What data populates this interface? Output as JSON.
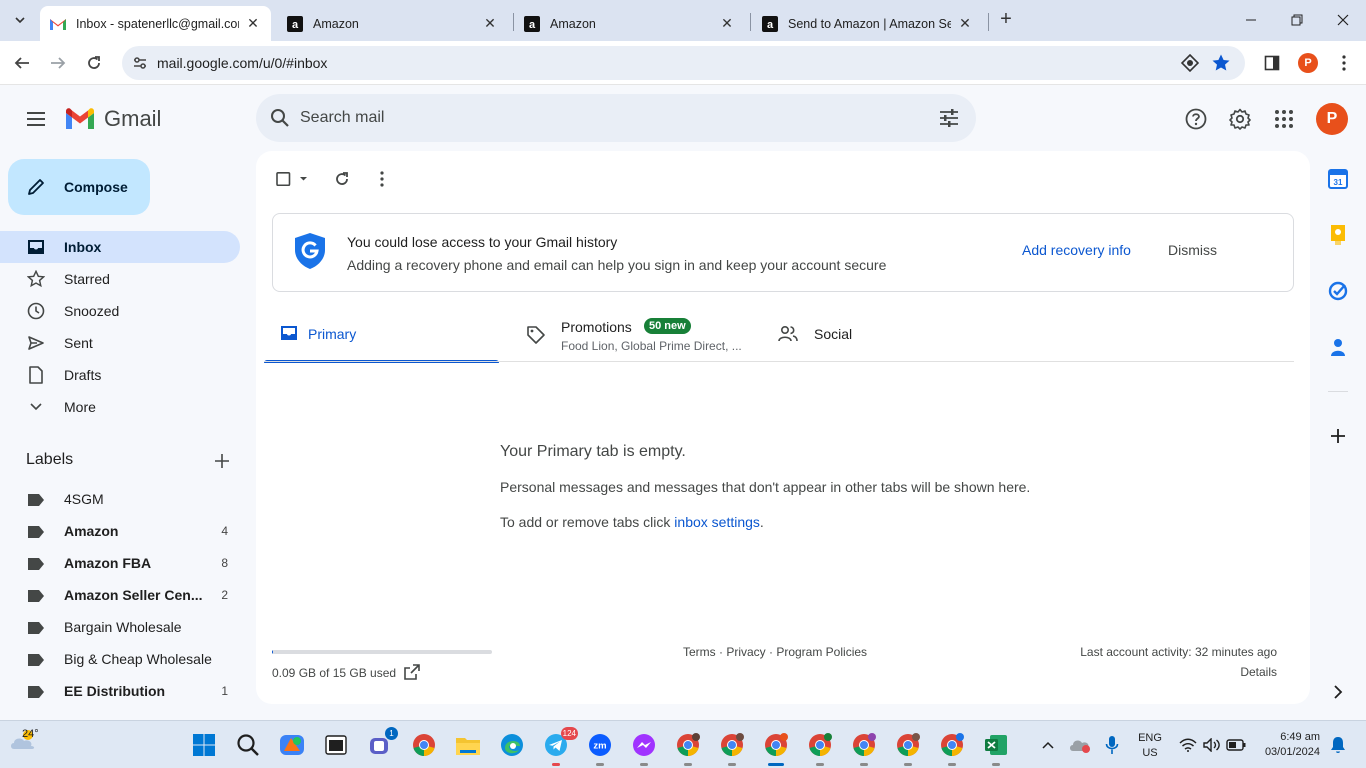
{
  "browser": {
    "tabs": [
      {
        "title": "Inbox - spatenerllc@gmail.com",
        "favicon": "gmail-icon",
        "active": true
      },
      {
        "title": "Amazon",
        "favicon": "amazon-icon",
        "active": false
      },
      {
        "title": "Amazon",
        "favicon": "amazon-icon",
        "active": false
      },
      {
        "title": "Send to Amazon | Amazon Seller Central",
        "favicon": "amazon-icon",
        "active": false
      }
    ],
    "url": "mail.google.com/u/0/#inbox",
    "profile_initial": "P"
  },
  "gmail": {
    "logo_text": "Gmail",
    "search_placeholder": "Search mail",
    "avatar_initial": "P",
    "compose_label": "Compose",
    "nav": [
      {
        "label": "Inbox",
        "icon": "inbox-icon",
        "active": true
      },
      {
        "label": "Starred",
        "icon": "star-icon",
        "active": false
      },
      {
        "label": "Snoozed",
        "icon": "clock-icon",
        "active": false
      },
      {
        "label": "Sent",
        "icon": "send-icon",
        "active": false
      },
      {
        "label": "Drafts",
        "icon": "draft-icon",
        "active": false
      },
      {
        "label": "More",
        "icon": "chevron-down-icon",
        "active": false
      }
    ],
    "labels_heading": "Labels",
    "labels": [
      {
        "name": "4SGM",
        "count": "",
        "bold": false
      },
      {
        "name": "Amazon",
        "count": "4",
        "bold": true
      },
      {
        "name": "Amazon FBA",
        "count": "8",
        "bold": true
      },
      {
        "name": "Amazon Seller Cen...",
        "count": "2",
        "bold": true
      },
      {
        "name": "Bargain Wholesale",
        "count": "",
        "bold": false
      },
      {
        "name": "Big & Cheap Wholesale",
        "count": "",
        "bold": false
      },
      {
        "name": "EE Distribution",
        "count": "1",
        "bold": true
      }
    ],
    "banner": {
      "title": "You could lose access to your Gmail history",
      "subtitle": "Adding a recovery phone and email can help you sign in and keep your account secure",
      "action": "Add recovery info",
      "dismiss": "Dismiss"
    },
    "tabs": {
      "primary": "Primary",
      "promotions": "Promotions",
      "promotions_badge": "50 new",
      "promotions_snippet": "Food Lion, Global Prime Direct, ...",
      "social": "Social"
    },
    "empty": {
      "heading": "Your Primary tab is empty.",
      "line1": "Personal messages and messages that don't appear in other tabs will be shown here.",
      "line2_prefix": "To add or remove tabs click ",
      "line2_link": "inbox settings",
      "line2_suffix": "."
    },
    "footer": {
      "storage": "0.09 GB of 15 GB used",
      "storage_fraction": 0.006,
      "links": "Terms · Privacy · Program Policies",
      "activity": "Last account activity: 32 minutes ago",
      "details": "Details"
    }
  },
  "taskbar": {
    "weather": "24°",
    "badges": {
      "teams": "1",
      "telegram": "124"
    },
    "lang1": "ENG",
    "lang2": "US",
    "time": "6:49 am",
    "date": "03/01/2024"
  },
  "colors": {
    "accent": "#0b57d0",
    "compose_bg": "#c2e7ff",
    "active_nav": "#d3e3fd",
    "badge_green": "#188038",
    "avatar": "#e8501b"
  }
}
